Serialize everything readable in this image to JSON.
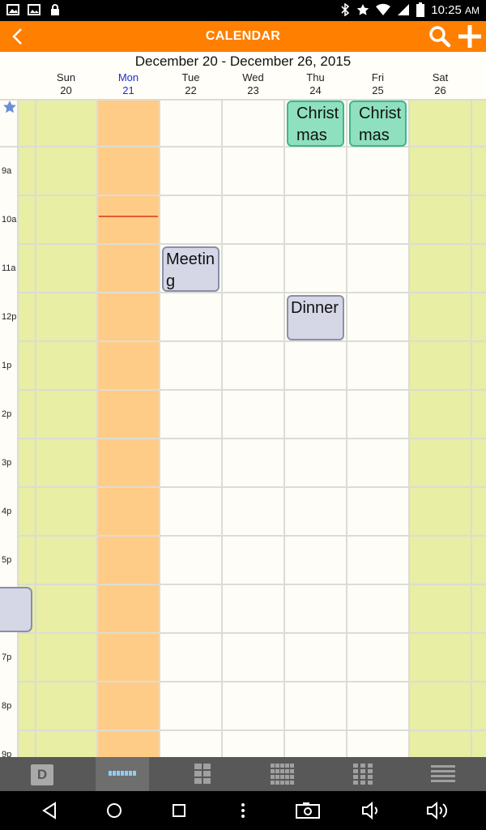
{
  "status_bar": {
    "time": "10:25",
    "ampm": "AM",
    "left_icons": [
      "image-icon",
      "gallery-icon",
      "lock-icon"
    ],
    "right_icons": [
      "bluetooth-icon",
      "star-icon",
      "wifi-icon",
      "signal-icon",
      "battery-icon"
    ]
  },
  "app_bar": {
    "title": "CALENDAR",
    "back_icon": "back-icon",
    "search_icon": "search-icon",
    "add_icon": "add-icon",
    "color": "#ff7f00"
  },
  "week": {
    "range": "December 20 - December 26, 2015",
    "days": [
      {
        "name": "Sun",
        "date": "20",
        "today": false
      },
      {
        "name": "Mon",
        "date": "21",
        "today": true
      },
      {
        "name": "Tue",
        "date": "22",
        "today": false
      },
      {
        "name": "Wed",
        "date": "23",
        "today": false
      },
      {
        "name": "Thu",
        "date": "24",
        "today": false
      },
      {
        "name": "Fri",
        "date": "25",
        "today": false
      },
      {
        "name": "Sat",
        "date": "26",
        "today": false
      }
    ]
  },
  "time_labels": [
    "9a",
    "10a",
    "11a",
    "12p",
    "1p",
    "2p",
    "3p",
    "4p",
    "5p",
    "6p",
    "7p",
    "8p",
    "9p"
  ],
  "events": {
    "christmas_thu": {
      "title": "Christmas",
      "day": "Thu",
      "all_day": true
    },
    "christmas_fri": {
      "title": "Christmas",
      "day": "Fri",
      "all_day": true
    },
    "meeting": {
      "title": "Meeting",
      "day": "Tue",
      "start": "11a"
    },
    "dinner": {
      "title": "Dinner",
      "day": "Thu",
      "start": "12p"
    },
    "unnamed_sat": {
      "title": "",
      "day": "Sat",
      "start": "6p"
    }
  },
  "colors": {
    "weekend_bg": "#e8eea3",
    "today_bg": "#ffcc88",
    "event_green": "#8ee0bf",
    "event_blue": "#d5d7e7"
  },
  "toolbar": {
    "day_label": "D",
    "views": [
      "day-view-icon",
      "week-view-icon",
      "month-list-icon",
      "month-view-icon",
      "year-view-icon",
      "agenda-view-icon"
    ]
  },
  "nav_bar": {
    "icons": [
      "nav-back-icon",
      "home-icon",
      "recents-icon",
      "menu-icon",
      "screenshot-icon",
      "volume-down-icon",
      "volume-up-icon"
    ]
  }
}
